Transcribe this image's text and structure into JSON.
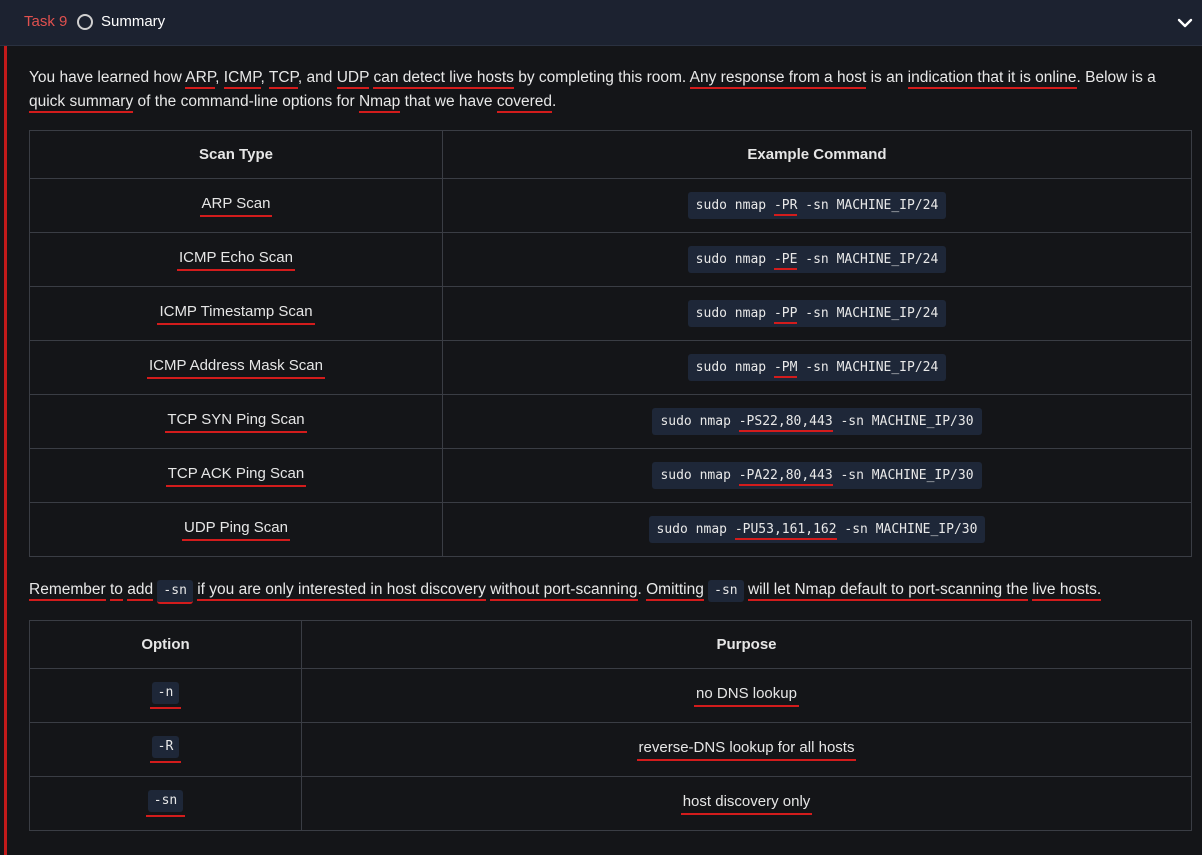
{
  "header": {
    "task_label": "Task 9",
    "title": "Summary",
    "status_icon": "circle-outline-icon",
    "toggle_icon": "chevron-down-icon"
  },
  "intro": {
    "p1": "You have learned how ",
    "arp": "ARP",
    "c1": ", ",
    "icmp": "ICMP",
    "c2": ", ",
    "tcp": "TCP",
    "c3": ", and ",
    "udp": "UDP",
    "s1": " ",
    "detect": "can detect live hosts",
    "s2": " by completing this room. ",
    "response": "Any response from a host",
    "s3": " is an ",
    "indication": "indication that it is online",
    "s4": ". Below is a ",
    "quick": "quick summary",
    "s5": " of the command-line options for ",
    "nmap": "Nmap",
    "s6": " that we have ",
    "covered": "covered",
    "s7": "."
  },
  "scan_table": {
    "headers": [
      "Scan Type",
      "Example Command"
    ],
    "rows": [
      {
        "type": "ARP Scan",
        "cmd_pre": "sudo nmap ",
        "flag": "-PR",
        "cmd_post": " -sn MACHINE_IP/24"
      },
      {
        "type": "ICMP Echo Scan",
        "cmd_pre": "sudo nmap ",
        "flag": "-PE",
        "cmd_post": " -sn MACHINE_IP/24"
      },
      {
        "type": "ICMP Timestamp Scan",
        "cmd_pre": "sudo nmap ",
        "flag": "-PP",
        "cmd_post": " -sn MACHINE_IP/24"
      },
      {
        "type": "ICMP Address Mask Scan",
        "cmd_pre": "sudo nmap ",
        "flag": "-PM",
        "cmd_post": " -sn MACHINE_IP/24"
      },
      {
        "type": "TCP SYN Ping Scan",
        "cmd_pre": "sudo nmap ",
        "flag": "-PS22,80,443",
        "cmd_post": " -sn MACHINE_IP/30"
      },
      {
        "type": "TCP ACK Ping Scan",
        "cmd_pre": "sudo nmap ",
        "flag": "-PA22,80,443",
        "cmd_post": " -sn MACHINE_IP/30"
      },
      {
        "type": "UDP Ping Scan",
        "cmd_pre": "sudo nmap ",
        "flag": "-PU53,161,162",
        "cmd_post": " -sn MACHINE_IP/30"
      }
    ]
  },
  "note": {
    "remember": "Remember",
    "to": "to",
    "add": "add",
    "code1": "-sn",
    "if_part": "if you are only interested in host discovery",
    "without": "without port-scanning",
    "dot": ". ",
    "omitting": "Omitting",
    "code2": "-sn",
    "will_let": "will let Nmap default to port-scanning the",
    "live": "live hosts."
  },
  "option_table": {
    "headers": [
      "Option",
      "Purpose"
    ],
    "rows": [
      {
        "option": "-n",
        "purpose": "no DNS lookup"
      },
      {
        "option": "-R",
        "purpose": "reverse-DNS lookup for all hosts"
      },
      {
        "option": "-sn",
        "purpose": "host discovery only"
      }
    ]
  },
  "colors": {
    "accent_red": "#d31c1c",
    "task_label": "#e0514f",
    "code_bg": "#1e2738",
    "page_bg": "#141518",
    "header_bg": "#1c2230"
  }
}
